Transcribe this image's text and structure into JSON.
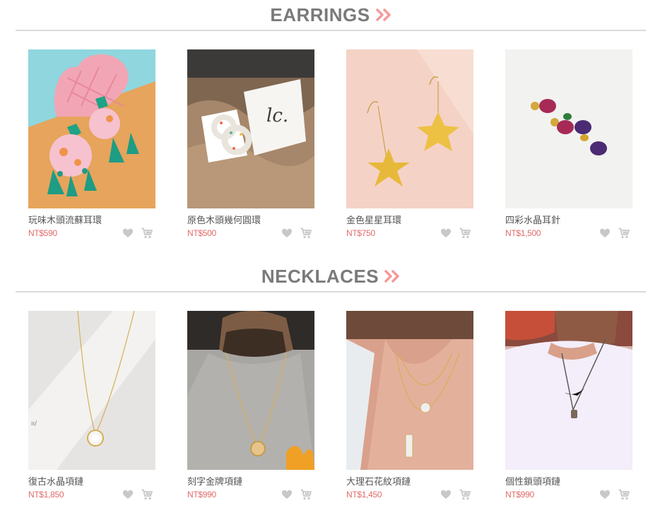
{
  "colors": {
    "heading": "#7a7a7a",
    "accent": "#f49a9a",
    "price": "#e36a6a",
    "icon": "#c8c8c8",
    "divider": "#dadada"
  },
  "sections": [
    {
      "title": "EARRINGS",
      "products": [
        {
          "name": "玩味木頭流蘇耳環",
          "price": "NT$590",
          "image": "pastel-tassel-earrings-photo"
        },
        {
          "name": "原色木頭幾何圓環",
          "price": "NT$500",
          "image": "wood-geometric-earrings-photo"
        },
        {
          "name": "金色星星耳環",
          "price": "NT$750",
          "image": "gold-star-earrings-photo"
        },
        {
          "name": "四彩水晶耳針",
          "price": "NT$1,500",
          "image": "crystal-drop-earrings-photo"
        }
      ]
    },
    {
      "title": "NECKLACES",
      "products": [
        {
          "name": "復古水晶項鏈",
          "price": "NT$1,850",
          "image": "vintage-crystal-necklace-photo"
        },
        {
          "name": "刻字金牌項鏈",
          "price": "NT$990",
          "image": "engraved-gold-pendant-photo"
        },
        {
          "name": "大理石花紋項鏈",
          "price": "NT$1,450",
          "image": "marble-pendant-necklace-photo"
        },
        {
          "name": "個性鎖頭項鏈",
          "price": "NT$990",
          "image": "padlock-necklace-photo"
        }
      ]
    }
  ],
  "icons": {
    "favorite": "heart-icon",
    "cart": "cart-icon",
    "more": "double-chevron-right-icon"
  }
}
